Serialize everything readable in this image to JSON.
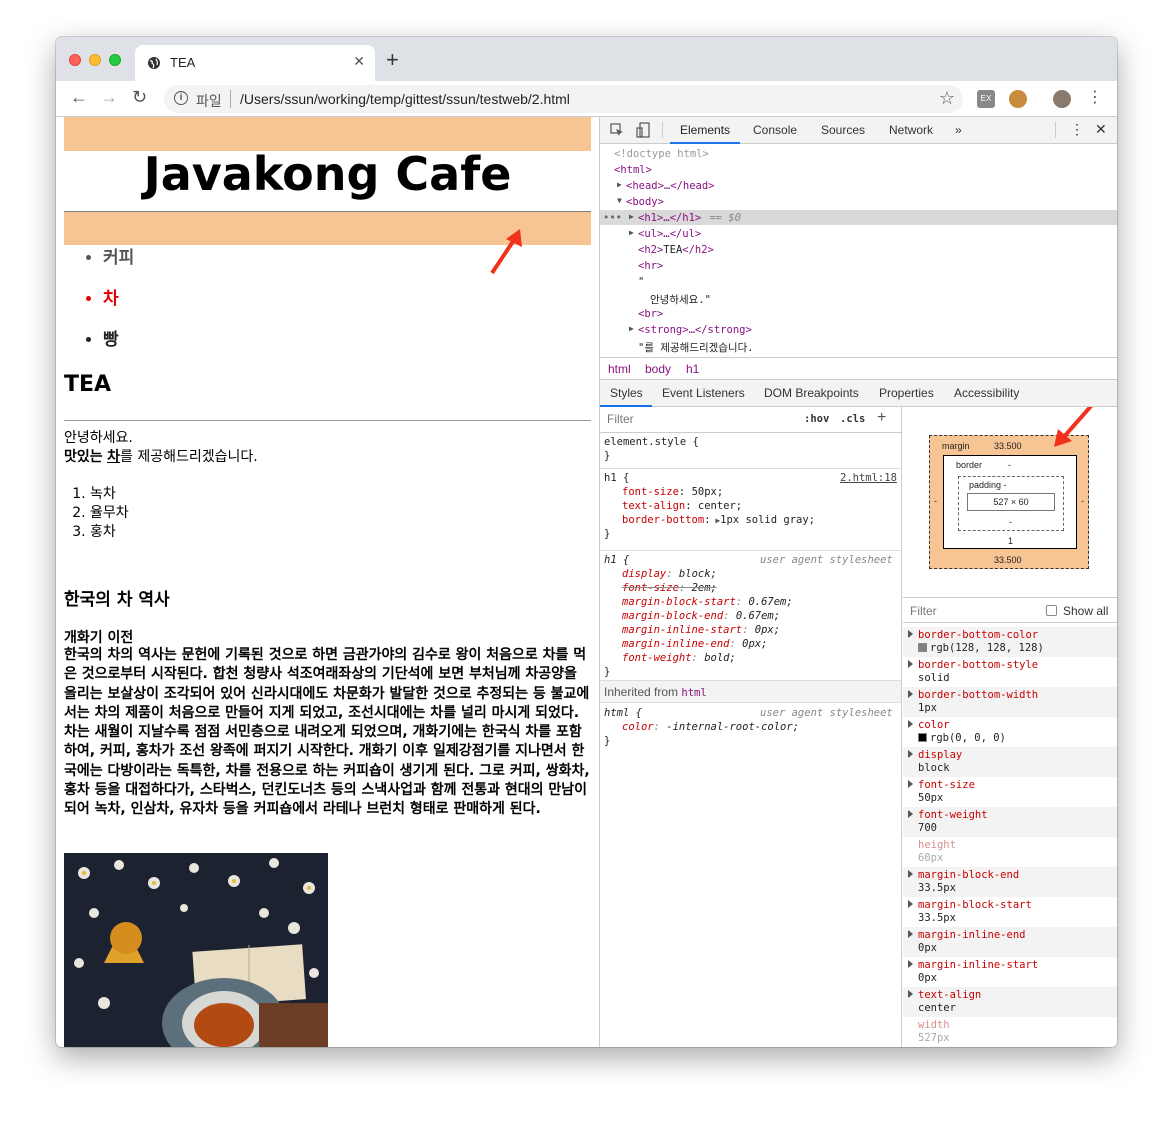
{
  "browser": {
    "tab_title": "TEA",
    "url_scheme": "파일",
    "url": "/Users/ssun/working/temp/gittest/ssun/testweb/2.html"
  },
  "page": {
    "h1": "Javakong Cafe",
    "menu": [
      "커피",
      "차",
      "빵"
    ],
    "h2": "TEA",
    "greeting": "안녕하세요.",
    "tasty": "맛있는",
    "tea": "차",
    "serve": "를 제공해드리겠습니다.",
    "teas": [
      "녹차",
      "율무차",
      "홍차"
    ],
    "history_title": "한국의 차 역사",
    "history_sub": "개화기 이전",
    "history_text": "한국의 차의 역사는 문헌에 기록된 것으로 하면 금관가야의 김수로 왕이 처음으로 차를 먹은 것으로부터 시작된다. 합천 청량사 석조여래좌상의 기단석에 보면 부처님께 차공양을 올리는 보살상이 조각되어 있어 신라시대에도 차문화가 발달한 것으로 추정되는 등 불교에서는 차의 제품이 처음으로 만들어 지게 되었고, 조선시대에는 차를 널리 마시게 되었다. 차는 새월이 지날수록 점점 서민층으로 내려오게 되었으며, 개화기에는 한국식 차를 포함하여, 커피, 홍차가 조선 왕족에 퍼지기 시작한다. 개화기 이후 일제강점기를 지나면서 한국에는 다방이라는 독특한, 차를 전용으로 하는 커피숍이 생기게 된다. 그로 커피, 쌍화차, 홍차 등을 대접하다가, 스타벅스, 던킨도너츠 등의 스낵사업과 함께 전통과 현대의 만남이 되어 녹차, 인삼차, 유자차 등을 커피숍에서 라테나 브런치 형태로 판매하게 된다."
  },
  "devtools": {
    "tabs": [
      "Elements",
      "Console",
      "Sources",
      "Network",
      "»"
    ],
    "dom": {
      "doctype": "<!doctype html>",
      "html_open": "<html>",
      "head": "<head>…</head>",
      "body_open": "<body>",
      "h1": "<h1>…</h1>",
      "h1_suffix": " == $0",
      "ul": "<ul>…</ul>",
      "h2_open": "<h2>",
      "h2_text": "TEA",
      "h2_close": "</h2>",
      "hr": "<hr>",
      "quote": "\"",
      "text_node": "안녕하세요.\"",
      "br": "<br>",
      "strong": "<strong>…</strong>",
      "text_node2": "\"를 제공해드리겠습니다."
    },
    "breadcrumbs": [
      "html",
      "body",
      "h1"
    ],
    "subtabs": [
      "Styles",
      "Event Listeners",
      "DOM Breakpoints",
      "Properties",
      "Accessibility"
    ],
    "styles": {
      "filter_placeholder": "Filter",
      "hov": ":hov",
      "cls": ".cls",
      "plus": "+",
      "element_style": "element.style {",
      "close": "}",
      "h1_selector": "h1 {",
      "h1_source": "2.html:18",
      "h1_rules": [
        {
          "prop": "font-size",
          "val": "50px;"
        },
        {
          "prop": "text-align",
          "val": "center;"
        },
        {
          "prop": "border-bottom",
          "val": "1px solid gray;"
        }
      ],
      "ua_selector": "h1 {",
      "ua_label": "user agent stylesheet",
      "ua_rules": [
        {
          "prop": "display",
          "val": "block;"
        },
        {
          "prop": "font-size",
          "val": "2em;"
        },
        {
          "prop": "margin-block-start",
          "val": "0.67em;"
        },
        {
          "prop": "margin-block-end",
          "val": "0.67em;"
        },
        {
          "prop": "margin-inline-start",
          "val": "0px;"
        },
        {
          "prop": "margin-inline-end",
          "val": "0px;"
        },
        {
          "prop": "font-weight",
          "val": "bold;"
        }
      ],
      "inherited_label": "Inherited from",
      "inherited_from": "html",
      "html_selector": "html {",
      "html_rules": [
        {
          "prop": "color",
          "val": "-internal-root-color;"
        }
      ]
    },
    "boxmodel": {
      "margin_label": "margin",
      "margin_top": "33.500",
      "margin_bottom": "33.500",
      "margin_side": "-",
      "border_label": "border",
      "border_top": "-",
      "border_bottom": "1",
      "padding_label": "padding -",
      "padding_bottom": "-",
      "content": "527 × 60"
    },
    "computed_filter": "Filter",
    "show_all": "Show all",
    "computed": [
      {
        "name": "border-bottom-color",
        "value": "rgb(128, 128, 128)",
        "swatch": "#808080"
      },
      {
        "name": "border-bottom-style",
        "value": "solid"
      },
      {
        "name": "border-bottom-width",
        "value": "1px"
      },
      {
        "name": "color",
        "value": "rgb(0, 0, 0)",
        "swatch": "#000000"
      },
      {
        "name": "display",
        "value": "block"
      },
      {
        "name": "font-size",
        "value": "50px"
      },
      {
        "name": "font-weight",
        "value": "700"
      },
      {
        "name": "height",
        "value": "60px",
        "inherited": true
      },
      {
        "name": "margin-block-end",
        "value": "33.5px"
      },
      {
        "name": "margin-block-start",
        "value": "33.5px"
      },
      {
        "name": "margin-inline-end",
        "value": "0px"
      },
      {
        "name": "margin-inline-start",
        "value": "0px"
      },
      {
        "name": "text-align",
        "value": "center"
      },
      {
        "name": "width",
        "value": "527px",
        "inherited": true
      }
    ]
  },
  "colors": {
    "highlight": "#f7c594",
    "accent": "#1a73e8",
    "active_menu": "#e00000",
    "annotation_arrow": "#f0311c"
  }
}
